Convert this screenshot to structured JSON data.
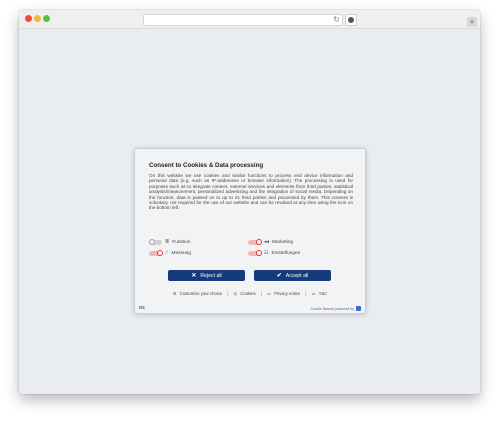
{
  "browser": {
    "reload_icon": "reload-icon",
    "corner_button": "+"
  },
  "dialog": {
    "title": "Consent to Cookies & Data processing",
    "body": "On this website we use cookies and similar functions to process end device information and personal data (e.g. such as IP-addresses or browser information). The processing is used for purposes such as to integrate content, external services and elements from third parties, statistical analysis/measurement, personalized advertising and the integration of social media. Depending on the function, data is passed on to up to 21 third parties and processed by them. This consent is voluntary, not required for the use of our website and can be revoked at any time using the icon on the bottom left.",
    "categories": [
      {
        "label": "Funktion",
        "state": "off",
        "icon": "≣"
      },
      {
        "label": "Marketing",
        "state": "on",
        "icon": "◂◂"
      },
      {
        "label": "Messung",
        "state": "on",
        "icon": "⟋"
      },
      {
        "label": "Einstellungen",
        "state": "on",
        "icon": "☷"
      }
    ],
    "reject_label": "Reject all",
    "accept_label": "Accept all",
    "links": {
      "customize": "Customize your choice",
      "cookies": "Cookies",
      "privacy": "Privacy notice",
      "tac": "T&C"
    },
    "footer_left": "NS",
    "footer_right": "Cookie Banner powered by"
  },
  "colors": {
    "button_bg": "#153b7c",
    "toggle_on": "#e2302f",
    "page_bg": "#e9edf2"
  }
}
